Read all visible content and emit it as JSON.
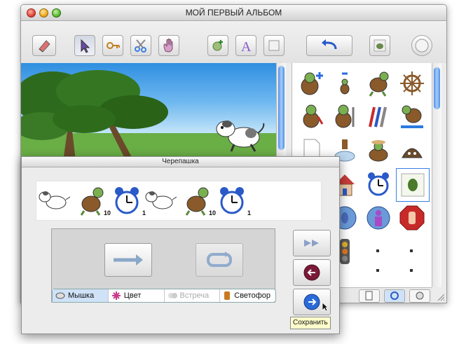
{
  "window": {
    "title": "МОЙ ПЕРВЫЙ АЛЬБОМ"
  },
  "toolbar": {
    "tools": [
      "eraser-tool",
      "arrow-tool",
      "key-tool",
      "scissors-tool",
      "hand-tool"
    ],
    "actions": [
      "new-character",
      "text",
      "rectangle"
    ],
    "undo": "undo",
    "stamp": "stamp",
    "color": "color-well"
  },
  "palette": {
    "items": [
      "turtle-plus",
      "turtle-minus",
      "turtle-walk",
      "ships-wheel",
      "turtle-paint",
      "turtle-pencil",
      "pencils",
      "turtle-water",
      "blank-page",
      "stamp",
      "turtle-hat",
      "turtle-shell",
      "house",
      "alarm-clock",
      "turtle-frame",
      "mouse-button",
      "person-button",
      "stop-hand",
      "traffic-light",
      "dot",
      "dot",
      "dot"
    ],
    "tabs": [
      "page",
      "clip",
      "click",
      "sound"
    ]
  },
  "dialog": {
    "title": "Черепашка",
    "strip": [
      {
        "icon": "dog",
        "count": ""
      },
      {
        "icon": "turtle",
        "count": "10"
      },
      {
        "icon": "alarm-clock",
        "count": "1"
      },
      {
        "icon": "dog",
        "count": ""
      },
      {
        "icon": "turtle",
        "count": "10"
      },
      {
        "icon": "alarm-clock",
        "count": "1"
      }
    ],
    "tabs": [
      {
        "label": "Мышка",
        "icon": "mouse",
        "active": true
      },
      {
        "label": "Цвет",
        "icon": "color-burst"
      },
      {
        "label": "Встреча",
        "icon": "meeting",
        "disabled": true
      },
      {
        "label": "Светофор",
        "icon": "traffic-light"
      }
    ],
    "side_buttons": [
      "fast-forward",
      "go-back",
      "save"
    ],
    "tooltip": "Сохранить"
  },
  "colors": {
    "accent": "#3a7ee8",
    "sky": "#2f8fe0",
    "tab_active": "#cfe2f7"
  }
}
